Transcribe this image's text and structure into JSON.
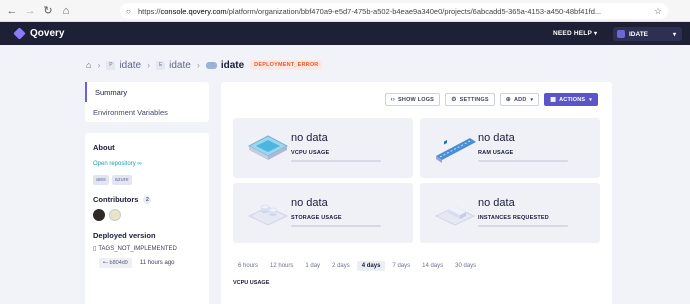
{
  "browser": {
    "url_scheme": "https://",
    "url_host": "console.qovery.com",
    "url_path": "/platform/organization/bbf470a9-e5d7-475b-a502-b4eae9a340e0/projects/6abcadd5-365a-4153-a450-48bf41fd..."
  },
  "topbar": {
    "logo_text": "Qovery",
    "need_help": "NEED HELP",
    "org_name": "IDATE"
  },
  "breadcrumb": {
    "org_letter": "P",
    "project": "idate",
    "env_letter": "E",
    "environment": "idate",
    "application": "idate",
    "status": "DEPLOYMENT_ERROR"
  },
  "sidebar": {
    "items": [
      {
        "label": "Summary"
      },
      {
        "label": "Environment Variables"
      }
    ]
  },
  "about": {
    "title": "About",
    "repo_link": "Open repository",
    "tags": [
      "aws",
      "azure"
    ],
    "contributors_title": "Contributors",
    "contributors_count": "2",
    "deployed_title": "Deployed version",
    "tag_text": "TAGS_NOT_IMPLEMENTED",
    "commit": "b804d9",
    "commit_time": "11 hours ago"
  },
  "toolbar": {
    "show_logs": "SHOW LOGS",
    "settings": "SETTINGS",
    "add": "ADD",
    "actions": "ACTIONS"
  },
  "metrics": [
    {
      "value": "no data",
      "label": "VCPU USAGE"
    },
    {
      "value": "no data",
      "label": "RAM USAGE"
    },
    {
      "value": "no data",
      "label": "STORAGE USAGE"
    },
    {
      "value": "no data",
      "label": "INSTANCES REQUESTED"
    }
  ],
  "time_ranges": [
    "6 hours",
    "12 hours",
    "1 day",
    "2 days",
    "4 days",
    "7 days",
    "14 days",
    "30 days"
  ],
  "active_range": "4 days",
  "chart_section_title": "VCPU USAGE",
  "colors": {
    "topbar": "#1e2036",
    "accent": "#5b55c8",
    "error": "#e55a33",
    "link": "#1a9fb0"
  }
}
